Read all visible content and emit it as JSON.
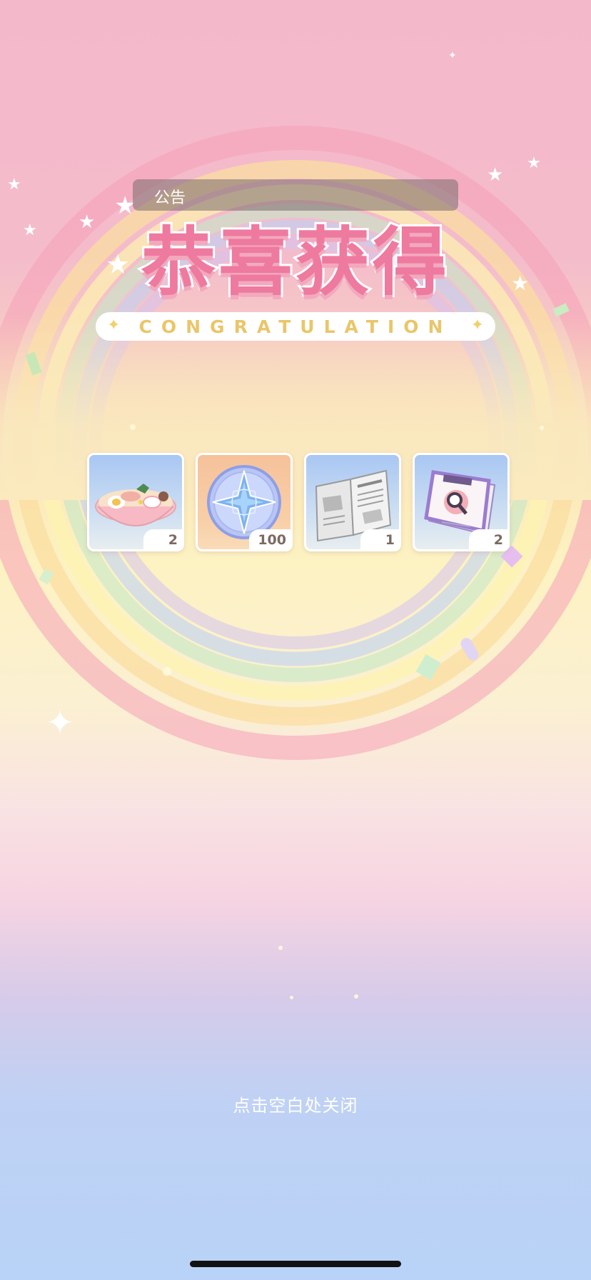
{
  "notice": {
    "label": "公告"
  },
  "title": {
    "main": "恭喜获得",
    "banner": "CONGRATULATION"
  },
  "rewards": [
    {
      "name": "ramen-bowl-icon",
      "quantity": "2",
      "bg": "blue"
    },
    {
      "name": "star-compass-coin-icon",
      "quantity": "100",
      "bg": "orange"
    },
    {
      "name": "newspaper-icon",
      "quantity": "1",
      "bg": "blue"
    },
    {
      "name": "magnifier-magazine-icon",
      "quantity": "2",
      "bg": "blue"
    }
  ],
  "footer": {
    "close_hint": "点击空白处关闭"
  },
  "colors": {
    "title_pink": "#ee7aa0",
    "banner_gold": "#e9c66a",
    "quantity_text": "#7b6a62"
  }
}
